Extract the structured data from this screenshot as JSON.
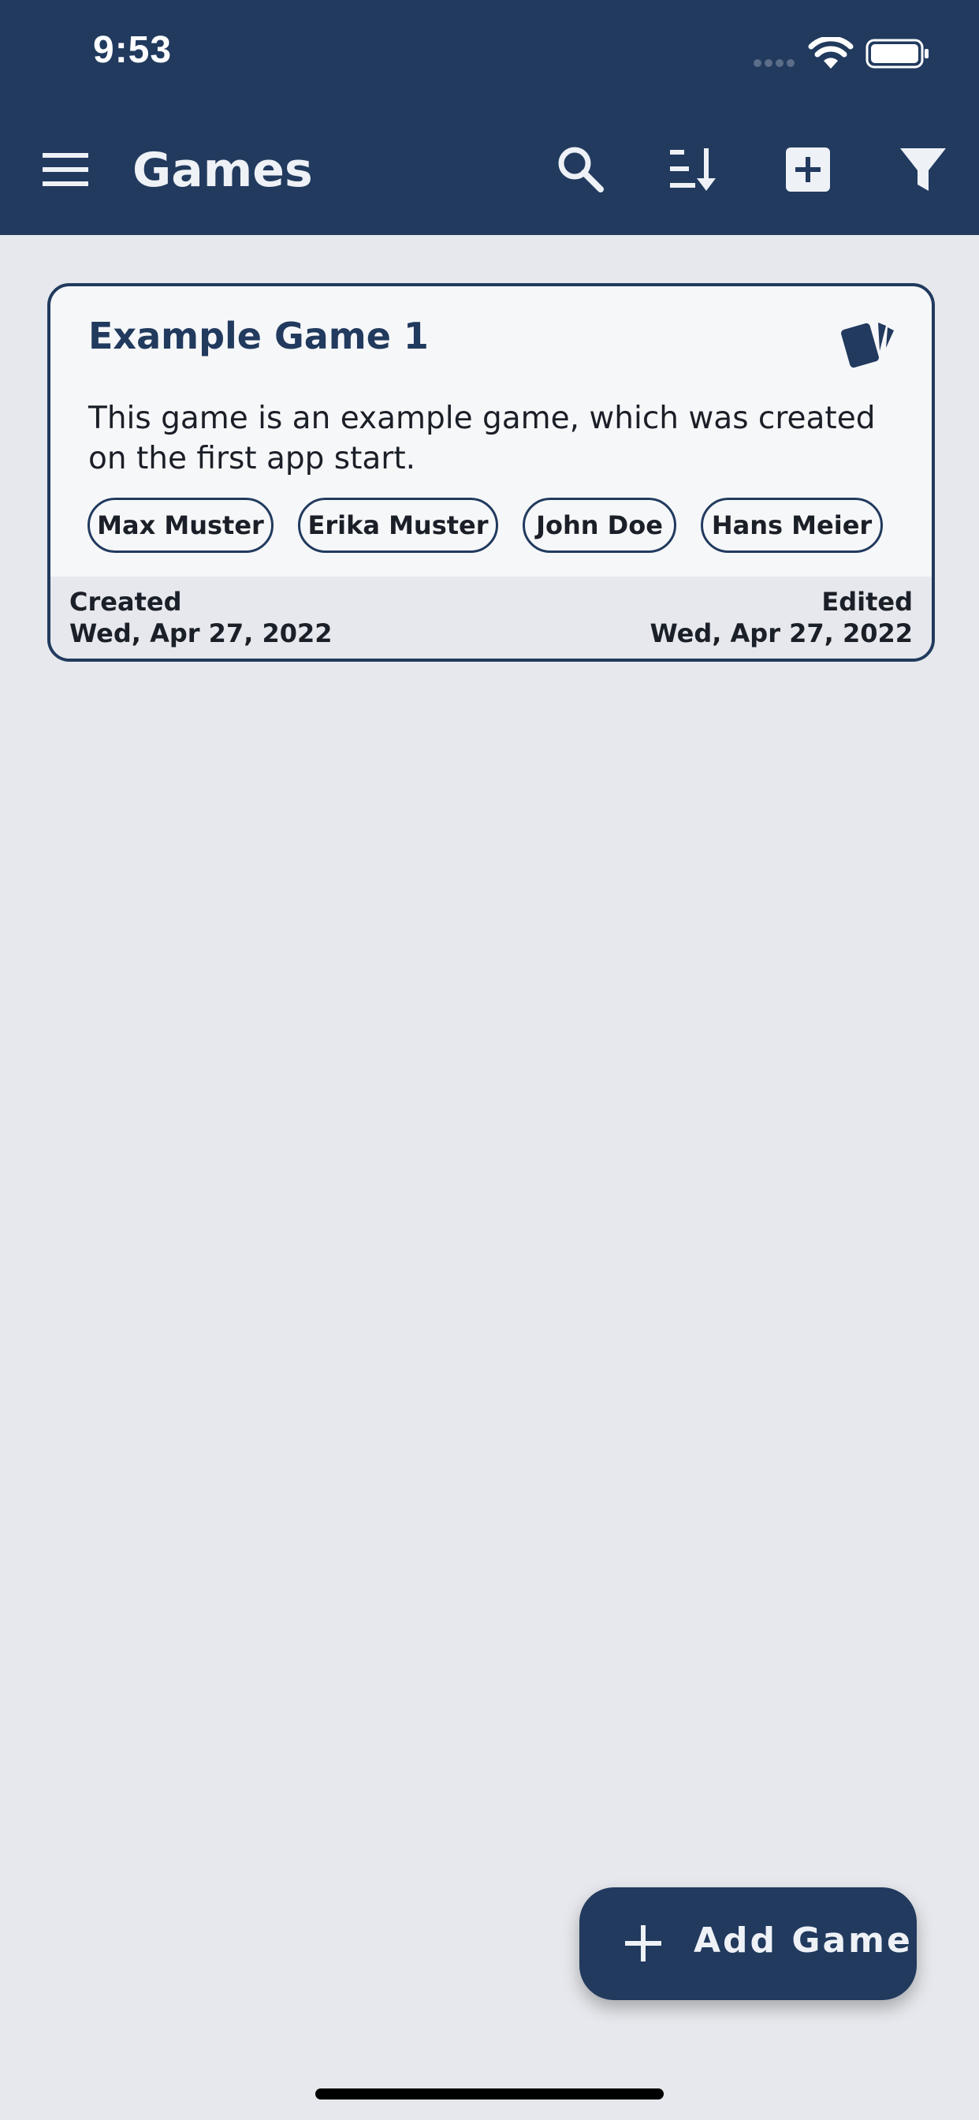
{
  "status_bar": {
    "time": "9:53"
  },
  "header": {
    "title": "Games"
  },
  "toolbar": {
    "menu_icon": "hamburger-menu-icon",
    "search_icon": "search-icon",
    "sort_icon": "sort-descending-icon",
    "add_icon": "add-box-icon",
    "filter_icon": "filter-icon"
  },
  "games": [
    {
      "title": "Example Game 1",
      "icon": "cards-icon",
      "description": "This game is an example game, which was created on the first app start.",
      "players": [
        "Max Muster",
        "Erika Muster",
        "John Doe",
        "Hans Meier"
      ],
      "created_label": "Created",
      "created_date": "Wed, Apr 27, 2022",
      "edited_label": "Edited",
      "edited_date": "Wed, Apr 27, 2022"
    }
  ],
  "fab": {
    "label": "Add Game",
    "icon": "plus-icon"
  },
  "colors": {
    "primary": "#213a5e",
    "background": "#e6e8ed",
    "card": "#f6f7f9",
    "text": "#1b1f27"
  }
}
